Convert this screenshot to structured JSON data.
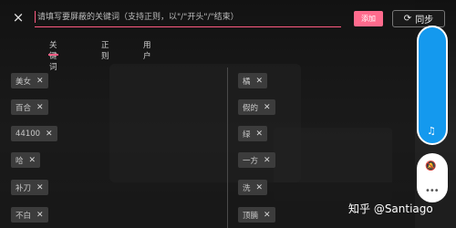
{
  "header": {
    "close_icon": "×",
    "search_placeholder": "请填写要屏蔽的关键词（支持正则，以\"/\"开头\"/\"结束）",
    "add_label": "添加",
    "sync_icon": "⟳",
    "sync_label": "同步"
  },
  "tabs": [
    {
      "label": "关键词",
      "active": true
    },
    {
      "label": "正则",
      "active": false
    },
    {
      "label": "用户",
      "active": false
    }
  ],
  "left_keywords": [
    "美女",
    "百合",
    "44100",
    "哈",
    "补刀",
    "不白"
  ],
  "right_keywords": [
    "橘",
    "假的",
    "绿",
    "一方",
    "洗",
    "顶腩"
  ],
  "chip_remove_glyph": "✕",
  "controls": {
    "music_icon": "♫",
    "bell_icon": "🔕",
    "dots_icon": "•••"
  },
  "watermark": "知乎 @Santiago",
  "colors": {
    "accent": "#ff5a82",
    "add_button": "#ff6b8d",
    "slider": "#1499ee"
  }
}
